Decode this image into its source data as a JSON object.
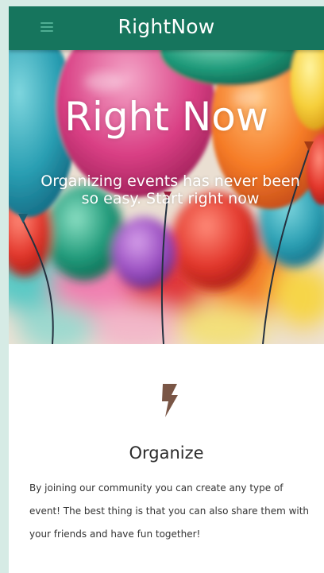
{
  "navbar": {
    "brand": "RightNow",
    "menu_icon": "hamburger-menu-icon",
    "background": "#16755d"
  },
  "hero": {
    "title": "Right Now",
    "subtitle": "Organizing events has never been so easy. Start right now",
    "image": "colorful-balloons"
  },
  "feature": {
    "icon": "lightning-bolt-icon",
    "icon_color": "#7a5646",
    "title": "Organize",
    "text": "By joining our community you can create any type of event! The best thing is that you can also share them with your friends and have fun together!"
  }
}
